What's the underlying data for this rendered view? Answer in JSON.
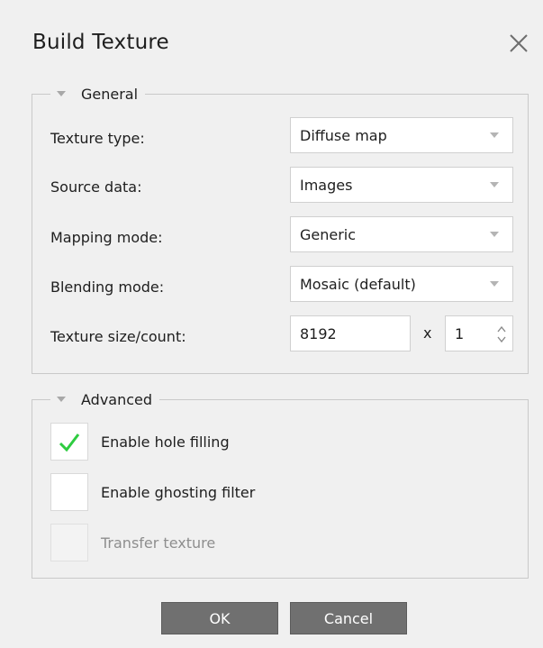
{
  "dialog": {
    "title": "Build Texture",
    "close_icon": "close-icon"
  },
  "general": {
    "legend": "General",
    "texture_type": {
      "label": "Texture type:",
      "value": "Diffuse map"
    },
    "source_data": {
      "label": "Source data:",
      "value": "Images"
    },
    "mapping_mode": {
      "label": "Mapping mode:",
      "value": "Generic"
    },
    "blending_mode": {
      "label": "Blending mode:",
      "value": "Mosaic (default)"
    },
    "texture_size": {
      "label": "Texture size/count:",
      "size": "8192",
      "times": "x",
      "count": "1"
    }
  },
  "advanced": {
    "legend": "Advanced",
    "hole_filling": {
      "label": "Enable hole filling",
      "checked": true
    },
    "ghosting_filter": {
      "label": "Enable ghosting filter",
      "checked": false
    },
    "transfer_texture": {
      "label": "Transfer texture",
      "checked": false,
      "disabled": true
    }
  },
  "buttons": {
    "ok": "OK",
    "cancel": "Cancel"
  },
  "colors": {
    "check": "#2ecc40",
    "button": "#707070",
    "background": "#f0f0f0"
  }
}
